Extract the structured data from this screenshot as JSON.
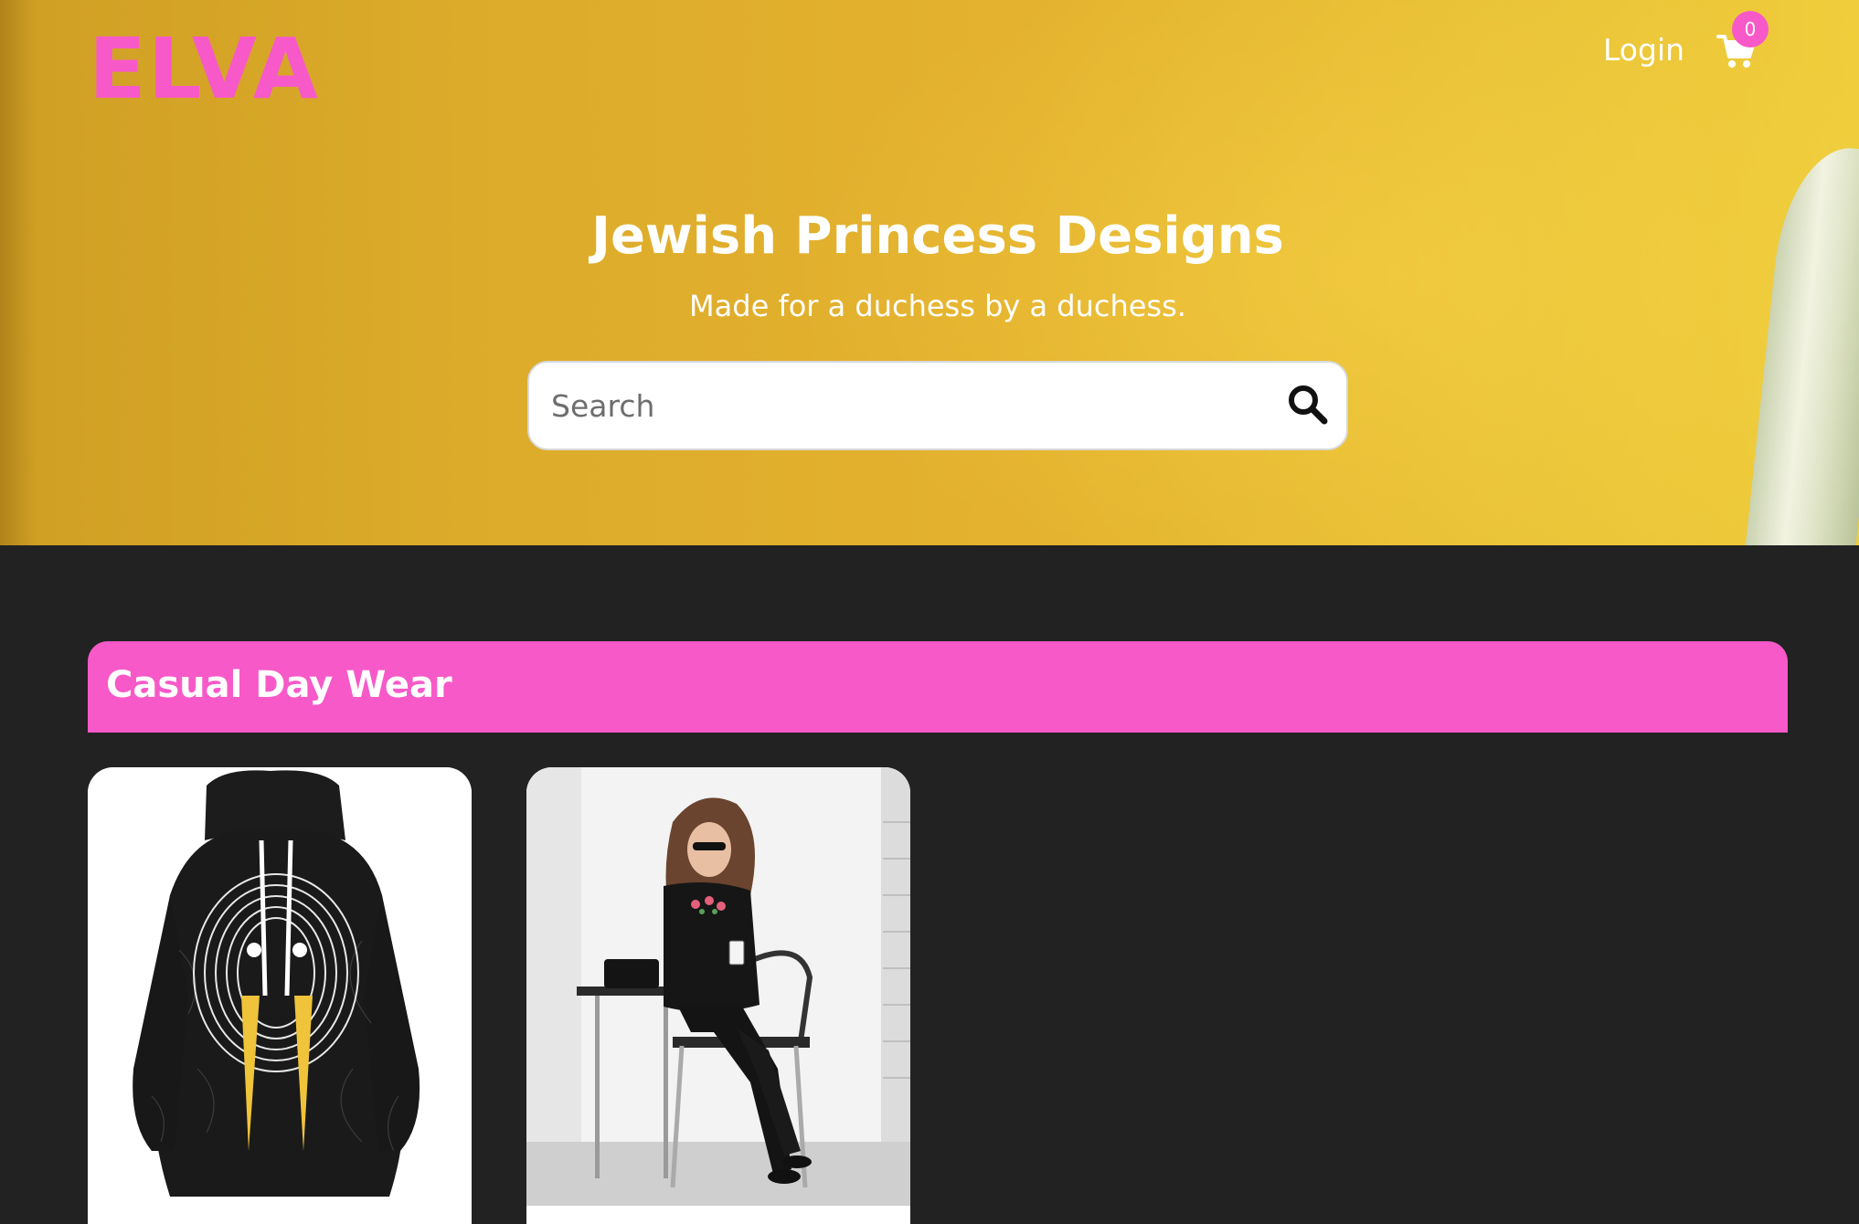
{
  "header": {
    "logo_text": "ELVA",
    "login_label": "Login",
    "cart_count": "0",
    "cart_icon": "shopping-cart-icon"
  },
  "hero": {
    "title": "Jewish Princess Designs",
    "subtitle": "Made for a duchess by a duchess."
  },
  "search": {
    "placeholder": "Search",
    "value": "",
    "icon": "search-icon"
  },
  "category": {
    "title": "Casual Day Wear",
    "products": [
      {
        "image": "hoodie-walrus-product-image"
      },
      {
        "image": "woman-seated-outfit-product-image"
      }
    ]
  },
  "colors": {
    "accent": "#f75ac8",
    "background": "#222222",
    "hero_yellow": "#e4b22e",
    "text_light": "#ffffff"
  }
}
